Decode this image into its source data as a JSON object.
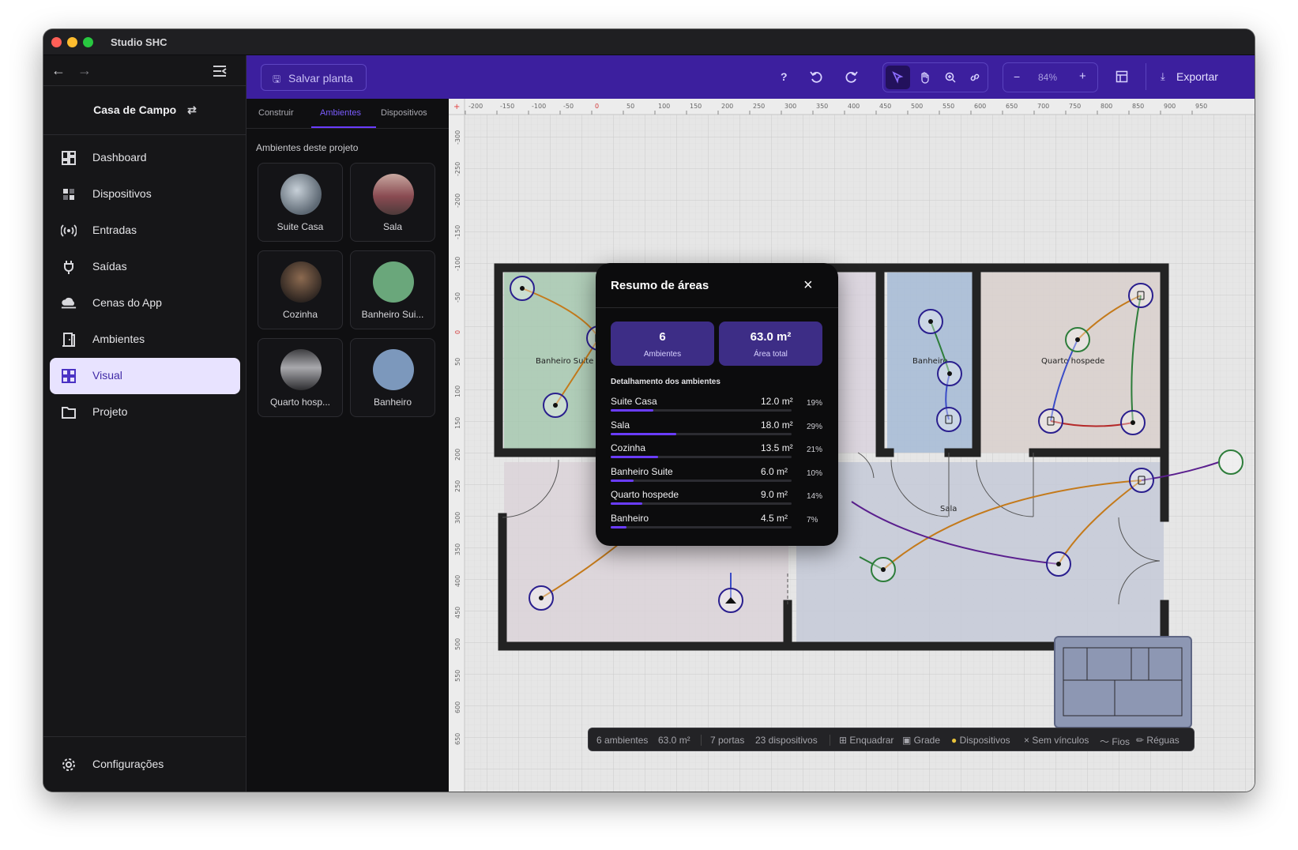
{
  "app": {
    "title": "Studio SHC"
  },
  "project": {
    "name": "Casa de Campo",
    "switch_icon": "swap-icon"
  },
  "sidebar": {
    "items": [
      {
        "label": "Dashboard",
        "icon": "dashboard-icon"
      },
      {
        "label": "Dispositivos",
        "icon": "devices-icon"
      },
      {
        "label": "Entradas",
        "icon": "broadcast-icon"
      },
      {
        "label": "Saídas",
        "icon": "plug-icon"
      },
      {
        "label": "Cenas do App",
        "icon": "cloud-icon"
      },
      {
        "label": "Ambientes",
        "icon": "door-icon"
      },
      {
        "label": "Visual",
        "icon": "grid-icon",
        "active": true
      },
      {
        "label": "Projeto",
        "icon": "folder-icon"
      }
    ],
    "settings_label": "Configurações"
  },
  "panel": {
    "tabs": [
      "Construir",
      "Ambientes",
      "Dispositivos"
    ],
    "active_tab": "Ambientes",
    "section_label": "Ambientes deste projeto",
    "rooms": [
      {
        "label": "Suite Casa",
        "thumb": "photo"
      },
      {
        "label": "Sala",
        "thumb": "photo"
      },
      {
        "label": "Cozinha",
        "thumb": "photo"
      },
      {
        "label": "Banheiro Sui...",
        "thumb": "color",
        "color": "#6aa77b"
      },
      {
        "label": "Quarto hosp...",
        "thumb": "photo"
      },
      {
        "label": "Banheiro",
        "thumb": "color",
        "color": "#7c98bc"
      }
    ]
  },
  "toolbar": {
    "save_label": "Salvar planta",
    "help": "?",
    "zoom": "84%",
    "zoom_minus": "−",
    "zoom_plus": "+",
    "export_label": "Exportar"
  },
  "ruler": {
    "top_ticks": [
      "-200",
      "-150",
      "-100",
      "-50",
      "0",
      "50",
      "100",
      "150",
      "200",
      "250",
      "300",
      "350",
      "400",
      "450",
      "500",
      "550",
      "600",
      "650",
      "700",
      "750",
      "800",
      "850",
      "900",
      "950"
    ],
    "left_ticks": [
      "-300",
      "-250",
      "-200",
      "-150",
      "-100",
      "-50",
      "0",
      "50",
      "100",
      "150",
      "200",
      "250",
      "300",
      "350",
      "400",
      "450",
      "500",
      "550",
      "600",
      "650"
    ]
  },
  "floorplan": {
    "room_labels": [
      "Banheiro Suite",
      "Banheiro",
      "Quarto hospede",
      "Sala"
    ]
  },
  "modal": {
    "title": "Resumo de áreas",
    "stats": [
      {
        "value": "6",
        "label": "Ambientes"
      },
      {
        "value": "63.0 m²",
        "label": "Área total"
      }
    ],
    "details_title": "Detalhamento dos ambientes",
    "rows": [
      {
        "name": "Suite Casa",
        "area": "12.0 m²",
        "pct": "19%",
        "fraction": 0.19
      },
      {
        "name": "Sala",
        "area": "18.0 m²",
        "pct": "29%",
        "fraction": 0.29
      },
      {
        "name": "Cozinha",
        "area": "13.5 m²",
        "pct": "21%",
        "fraction": 0.21
      },
      {
        "name": "Banheiro Suite",
        "area": "6.0 m²",
        "pct": "10%",
        "fraction": 0.1
      },
      {
        "name": "Quarto hospede",
        "area": "9.0 m²",
        "pct": "14%",
        "fraction": 0.14
      },
      {
        "name": "Banheiro",
        "area": "4.5 m²",
        "pct": "7%",
        "fraction": 0.07
      }
    ]
  },
  "statusbar": {
    "ambientes": "6 ambientes",
    "area": "63.0 m²",
    "portas": "7 portas",
    "dispositivos": "23 dispositivos",
    "enquadrar": "Enquadrar",
    "grade": "Grade",
    "dispositivos_toggle": "Dispositivos",
    "vinculos": "Sem vínculos",
    "fios": "Fios",
    "reguas": "Réguas"
  }
}
